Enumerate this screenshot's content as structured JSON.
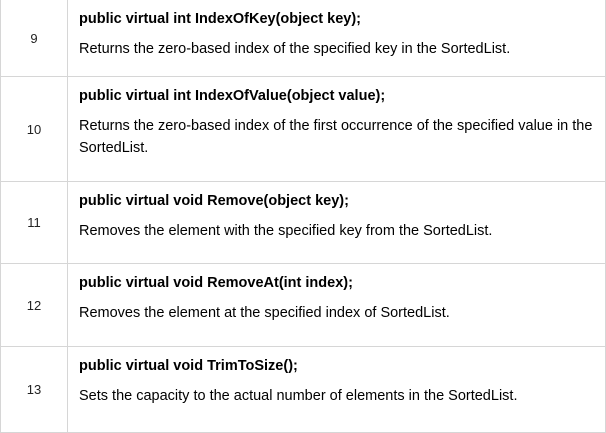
{
  "rows": [
    {
      "number": "9",
      "signature": "public virtual int IndexOfKey(object key);",
      "description": "Returns the zero-based index of the specified key in the SortedList."
    },
    {
      "number": "10",
      "signature": "public virtual int IndexOfValue(object value);",
      "description": "Returns the zero-based index of the first occurrence of the specified value in the SortedList."
    },
    {
      "number": "11",
      "signature": "public virtual void Remove(object key);",
      "description": "Removes the element with the specified key from the SortedList."
    },
    {
      "number": "12",
      "signature": "public virtual void RemoveAt(int index);",
      "description": "Removes the element at the specified index of SortedList."
    },
    {
      "number": "13",
      "signature": "public virtual void TrimToSize();",
      "description": "Sets the capacity to the actual number of elements in the SortedList."
    }
  ]
}
